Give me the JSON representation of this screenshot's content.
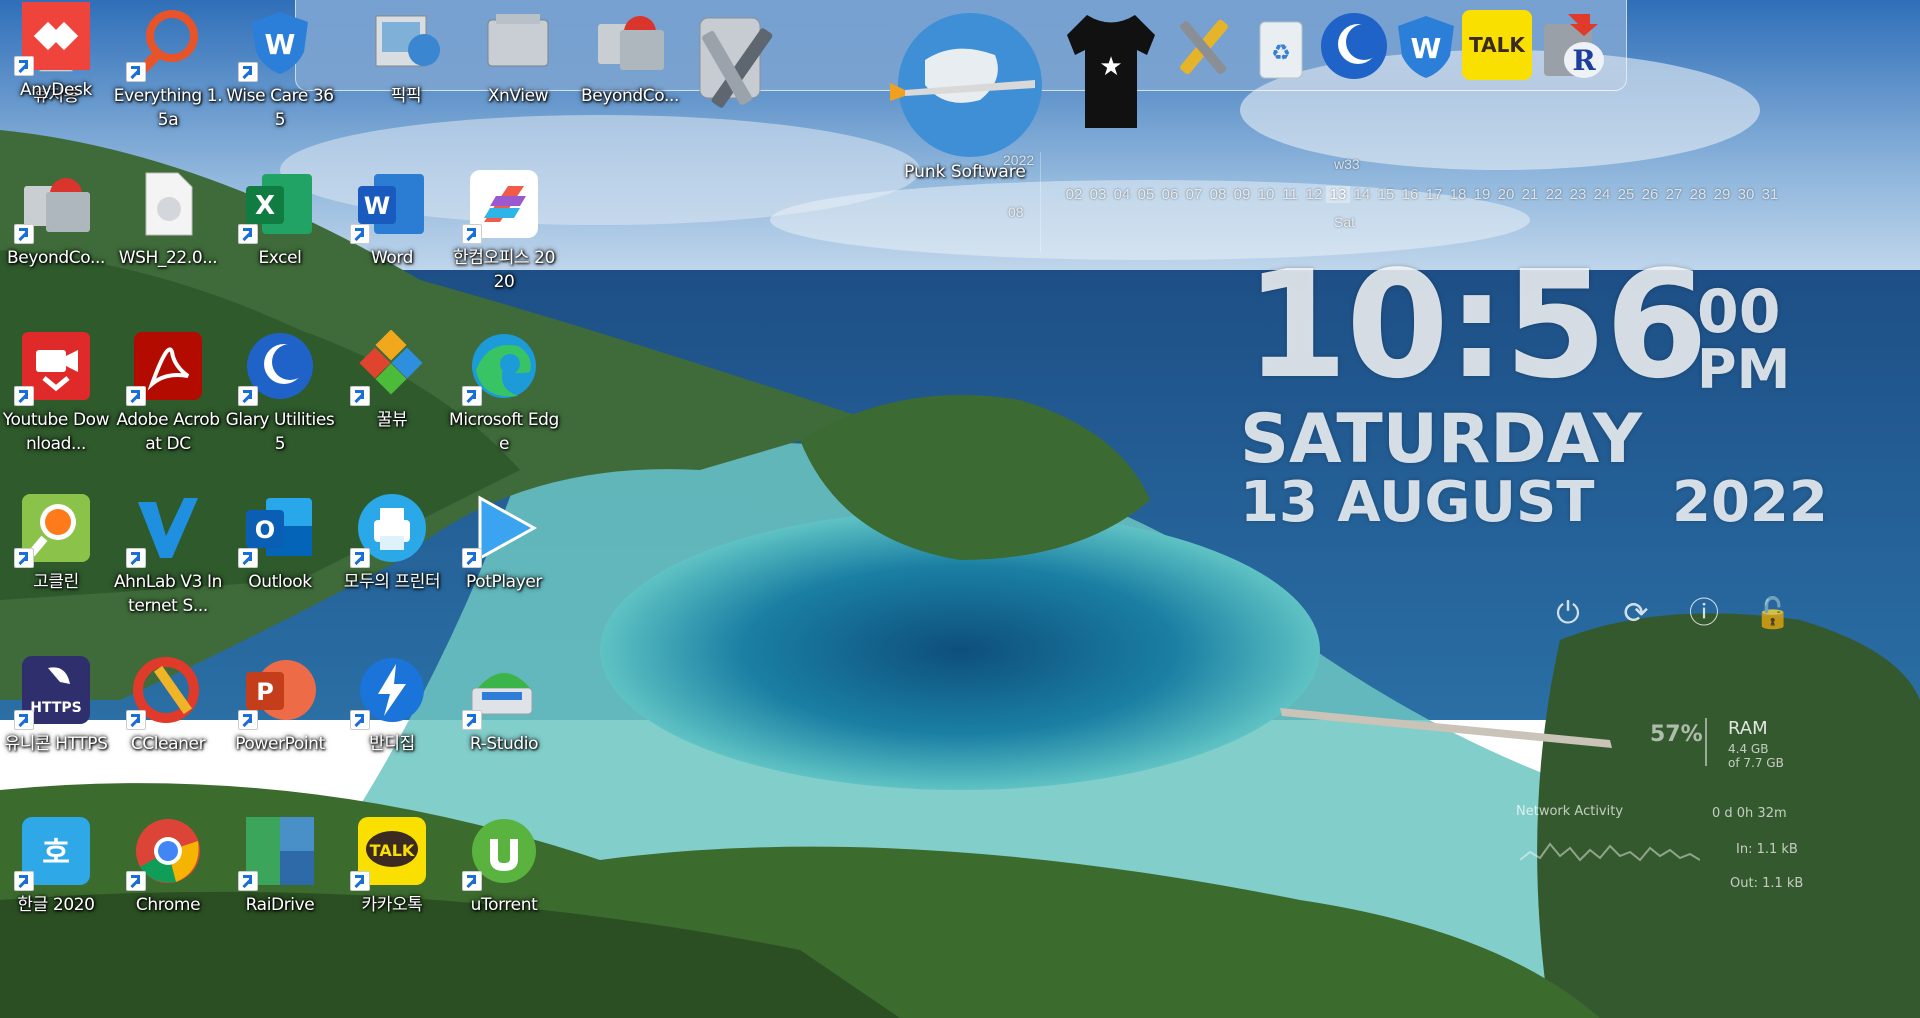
{
  "desktop": {
    "icons": [
      {
        "label": "휴지통",
        "icon": "recycle-bin-icon"
      },
      {
        "label": "Everything 1.5a",
        "icon": "everything-search-icon"
      },
      {
        "label": "Wise Care 365",
        "icon": "wise-care-icon"
      },
      {
        "label": "픽픽",
        "icon": "picpick-icon"
      },
      {
        "label": "XnView",
        "icon": "xnview-icon"
      },
      {
        "label": "BeyondCo...",
        "icon": "beyond-compare-icon"
      },
      {
        "label": "WSH_22.0...",
        "icon": "file-icon"
      },
      {
        "label": "Excel",
        "icon": "excel-icon"
      },
      {
        "label": "Word",
        "icon": "word-icon"
      },
      {
        "label": "한컴오피스 2020",
        "icon": "hancom-office-icon"
      },
      {
        "label": "Youtube Download...",
        "icon": "youtube-downloader-icon"
      },
      {
        "label": "Adobe Acrobat DC",
        "icon": "acrobat-icon"
      },
      {
        "label": "Glary Utilities 5",
        "icon": "glary-utilities-icon"
      },
      {
        "label": "꿀뷰",
        "icon": "honeyview-icon"
      },
      {
        "label": "Microsoft Edge",
        "icon": "edge-icon"
      },
      {
        "label": "고클린",
        "icon": "goclean-icon"
      },
      {
        "label": "AhnLab V3 Internet S...",
        "icon": "ahnlab-v3-icon"
      },
      {
        "label": "Outlook",
        "icon": "outlook-icon"
      },
      {
        "label": "모두의 프린터",
        "icon": "printer-icon"
      },
      {
        "label": "PotPlayer",
        "icon": "potplayer-icon"
      },
      {
        "label": "유니콘 HTTPS",
        "icon": "unicorn-https-icon"
      },
      {
        "label": "CCleaner",
        "icon": "ccleaner-icon"
      },
      {
        "label": "PowerPoint",
        "icon": "powerpoint-icon"
      },
      {
        "label": "반디집",
        "icon": "bandizip-icon"
      },
      {
        "label": "R-Studio",
        "icon": "r-studio-icon"
      },
      {
        "label": "한글 2020",
        "icon": "hangul-icon"
      },
      {
        "label": "Chrome",
        "icon": "chrome-icon"
      },
      {
        "label": "RaiDrive",
        "icon": "raidrive-icon"
      },
      {
        "label": "카카오톡",
        "icon": "kakaotalk-icon"
      },
      {
        "label": "uTorrent",
        "icon": "utorrent-icon"
      },
      {
        "label": "AnyDesk",
        "icon": "anydesk-icon"
      }
    ]
  },
  "dock": {
    "items": [
      {
        "icon": "settings-tools-icon"
      },
      {
        "icon": "punk-software-globe-icon",
        "label": "Punk Software"
      },
      {
        "icon": "tshirt-icon"
      },
      {
        "icon": "tools-icon"
      },
      {
        "icon": "recycle-bin-icon"
      },
      {
        "icon": "glary-utilities-icon"
      },
      {
        "icon": "wise-care-icon"
      },
      {
        "icon": "kakaotalk-icon",
        "text": "TALK"
      },
      {
        "icon": "r-studio-icon"
      }
    ]
  },
  "calendar": {
    "week": "w33",
    "year": "2022",
    "month": "08",
    "days": [
      "02",
      "03",
      "04",
      "05",
      "06",
      "07",
      "08",
      "09",
      "10",
      "11",
      "12",
      "13",
      "14",
      "15",
      "16",
      "17",
      "18",
      "19",
      "20",
      "21",
      "22",
      "23",
      "24",
      "25",
      "26",
      "27",
      "28",
      "29",
      "30",
      "31"
    ],
    "today": "13",
    "weekday_short": "Sat"
  },
  "clock": {
    "time": "10:56",
    "seconds": "00",
    "ampm": "PM",
    "weekday": "SATURDAY",
    "date": "13 AUGUST",
    "year": "2022"
  },
  "system": {
    "power_buttons": [
      "power-icon",
      "restart-icon",
      "shutdown-icon",
      "lock-icon"
    ],
    "ram_percent": "57%",
    "ram_label": "RAM",
    "ram_used": "4.4 GB",
    "ram_total": "of 7.7 GB",
    "network_label": "Network Activity",
    "uptime": "0 d 0h 32m",
    "net_in": "In: 1.1 kB",
    "net_out": "Out: 1.1 kB"
  }
}
